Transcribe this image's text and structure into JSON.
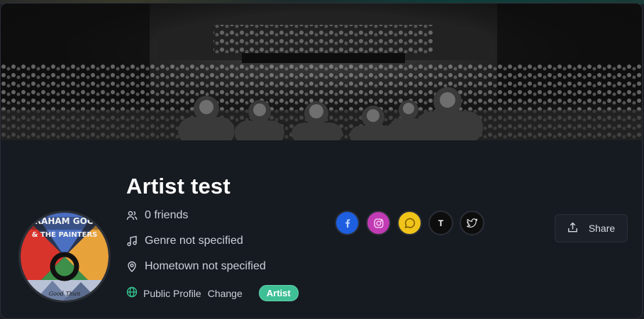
{
  "profile": {
    "name": "Artist test",
    "friends": "0 friends",
    "genre": "Genre not specified",
    "hometown": "Hometown not specified",
    "visibility": "Public Profile",
    "change_label": "Change",
    "badge": "Artist",
    "avatar_text_top": "GRAHAM GOOD",
    "avatar_text_mid": "& THE PAINTERS",
    "avatar_text_bottom": "Good Thun"
  },
  "socials": [
    {
      "name": "facebook",
      "icon": "facebook-icon",
      "color": "#1d5fe0"
    },
    {
      "name": "instagram",
      "icon": "instagram-icon",
      "color": "#c13bb4"
    },
    {
      "name": "chat",
      "icon": "chat-bubble-icon",
      "color": "#f0c419"
    },
    {
      "name": "t",
      "label": "T",
      "icon": "t-letter-icon",
      "color": "#0d0d0d"
    },
    {
      "name": "twitter",
      "icon": "twitter-icon",
      "color": "#0d0d0d"
    }
  ],
  "actions": {
    "share_label": "Share"
  },
  "colors": {
    "background": "#161a21",
    "badge": "#3fbf95",
    "globe": "#34c38f"
  }
}
